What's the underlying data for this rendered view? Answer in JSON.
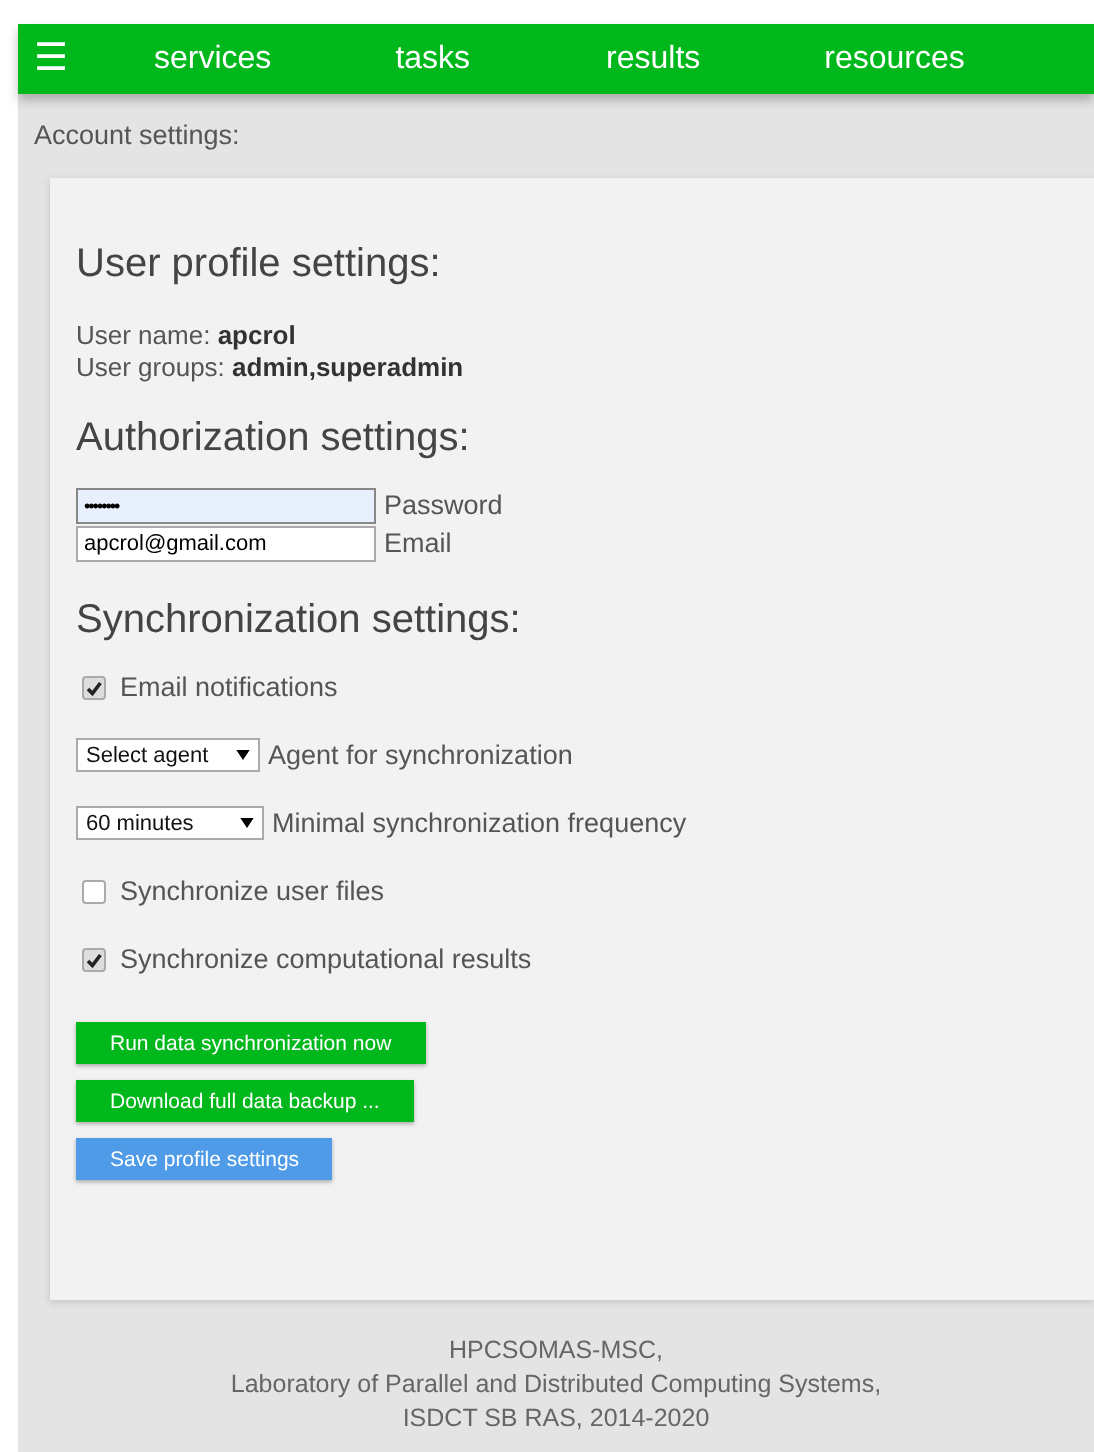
{
  "nav": {
    "menu_icon": "☰",
    "items": [
      {
        "label": "services"
      },
      {
        "label": "tasks"
      },
      {
        "label": "results"
      },
      {
        "label": "resources"
      }
    ]
  },
  "page_title": "Account settings:",
  "profile": {
    "heading": "User profile settings:",
    "fields": [
      {
        "label": "User name:",
        "value": "apcrol"
      },
      {
        "label": "User groups:",
        "value": "admin,superadmin"
      }
    ]
  },
  "authorization": {
    "heading": "Authorization settings:",
    "inputs": [
      {
        "kind": "password",
        "value": "••••••••",
        "label": "Password",
        "focused": true
      },
      {
        "kind": "text",
        "value": "apcrol@gmail.com",
        "label": "Email",
        "focused": false
      }
    ]
  },
  "synchronization": {
    "heading": "Synchronization settings:",
    "rows": [
      {
        "kind": "checkbox",
        "label": "Email notifications",
        "checked": true
      },
      {
        "kind": "select",
        "value": "Select agent",
        "label": "Agent for synchronization"
      },
      {
        "kind": "select",
        "value": "60 minutes",
        "label": "Minimal synchronization frequency"
      },
      {
        "kind": "checkbox",
        "label": "Synchronize user files",
        "checked": false
      },
      {
        "kind": "checkbox",
        "label": "Synchronize computational results",
        "checked": true
      }
    ]
  },
  "buttons": [
    {
      "label": "Run data synchronization now",
      "kind": "green"
    },
    {
      "label": "Download full data backup ...",
      "kind": "green"
    },
    {
      "label": "Save profile settings",
      "kind": "blue"
    }
  ],
  "footer": [
    "HPCSOMAS-MSC,",
    "Laboratory of Parallel and Distributed Computing Systems,",
    "ISDCT SB RAS, 2014-2020"
  ]
}
